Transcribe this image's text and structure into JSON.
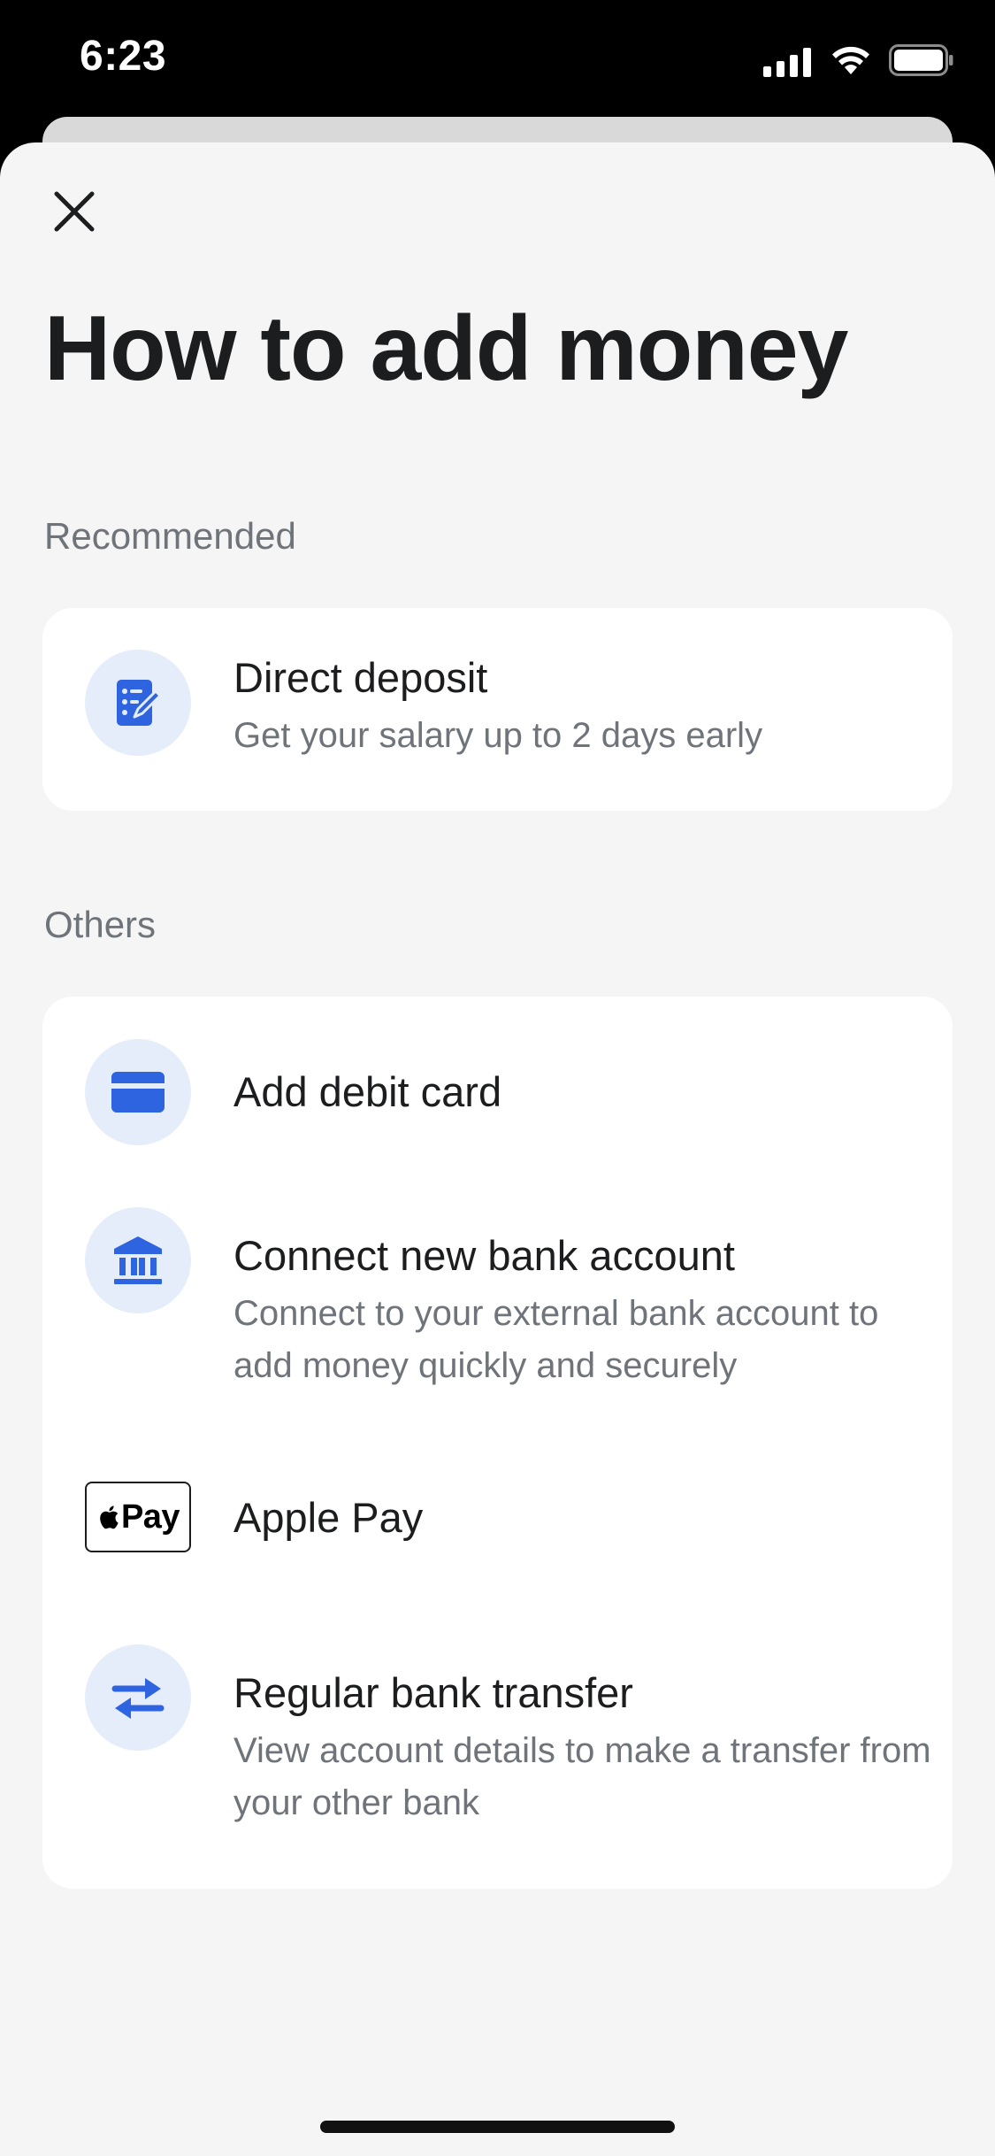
{
  "status_bar": {
    "time": "6:23"
  },
  "header": {
    "close_icon": "close-icon",
    "title": "How to add money"
  },
  "recommended": {
    "label": "Recommended",
    "items": [
      {
        "icon": "document-edit-icon",
        "title": "Direct deposit",
        "subtitle": "Get your salary up to 2 days early"
      }
    ]
  },
  "others": {
    "label": "Others",
    "items": [
      {
        "icon": "credit-card-icon",
        "title": "Add debit card"
      },
      {
        "icon": "bank-icon",
        "title": "Connect new bank account",
        "subtitle": "Connect to your external bank account to add money quickly and securely"
      },
      {
        "icon": "apple-pay-icon",
        "badge_text": "Pay",
        "title": "Apple Pay"
      },
      {
        "icon": "transfer-arrows-icon",
        "title": "Regular bank transfer",
        "subtitle": "View account details to make a transfer from your other bank"
      }
    ]
  },
  "colors": {
    "accent": "#2f64e0",
    "icon_bg": "#e6edfa",
    "sheet_bg": "#f5f5f5",
    "card_bg": "#ffffff",
    "text_primary": "#1c1d1f",
    "text_secondary": "#6f737a"
  }
}
